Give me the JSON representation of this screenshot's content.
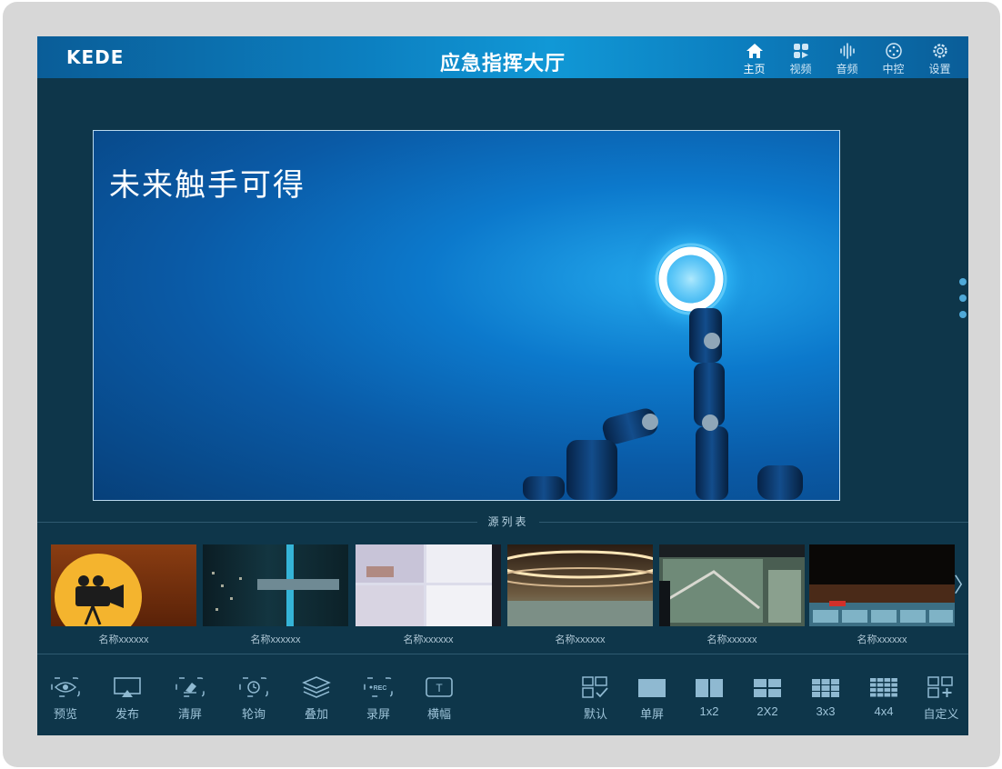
{
  "header": {
    "logo": "KEDE",
    "title": "应急指挥大厅",
    "nav": [
      {
        "label": "主页",
        "icon": "home-icon",
        "active": true
      },
      {
        "label": "视频",
        "icon": "video-grid-icon"
      },
      {
        "label": "音频",
        "icon": "audio-wave-icon"
      },
      {
        "label": "中控",
        "icon": "control-icon"
      },
      {
        "label": "设置",
        "icon": "gear-icon"
      }
    ]
  },
  "preview": {
    "slogan": "未来触手可得"
  },
  "sources": {
    "label": "源列表",
    "items": [
      {
        "name": "名称xxxxxx"
      },
      {
        "name": "名称xxxxxx"
      },
      {
        "name": "名称xxxxxx"
      },
      {
        "name": "名称xxxxxx"
      },
      {
        "name": "名称xxxxxx"
      },
      {
        "name": "名称xxxxxx"
      }
    ]
  },
  "toolbar": {
    "left": [
      {
        "label": "预览",
        "icon": "eye-icon"
      },
      {
        "label": "发布",
        "icon": "cast-icon"
      },
      {
        "label": "清屏",
        "icon": "eraser-icon"
      },
      {
        "label": "轮询",
        "icon": "timer-icon"
      },
      {
        "label": "叠加",
        "icon": "layers-icon"
      },
      {
        "label": "录屏",
        "icon": "record-icon",
        "badge": "REC"
      },
      {
        "label": "横幅",
        "icon": "banner-icon",
        "badge": "T"
      }
    ],
    "right": [
      {
        "label": "默认",
        "icon": "layout-default-icon"
      },
      {
        "label": "单屏",
        "icon": "layout-1x1-icon"
      },
      {
        "label": "1x2",
        "icon": "layout-1x2-icon"
      },
      {
        "label": "2X2",
        "icon": "layout-2x2-icon"
      },
      {
        "label": "3x3",
        "icon": "layout-3x3-icon"
      },
      {
        "label": "4x4",
        "icon": "layout-4x4-icon"
      },
      {
        "label": "自定义",
        "icon": "layout-custom-icon"
      }
    ]
  },
  "colors": {
    "background": "#0e364a",
    "header_accent": "#0c7fc0",
    "icon": "#8fb9d1"
  }
}
